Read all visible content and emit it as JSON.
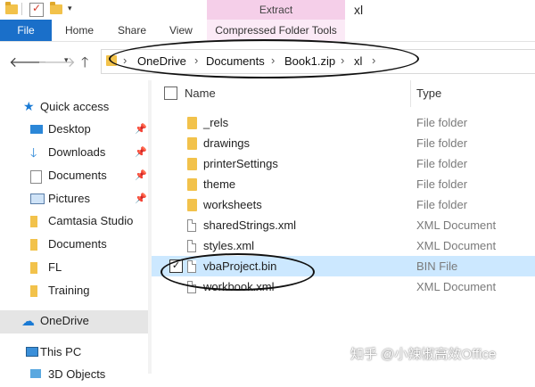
{
  "titlebar": {
    "contextual_group": "Extract",
    "window_title": "xl"
  },
  "ribbon": {
    "file": "File",
    "home": "Home",
    "share": "Share",
    "view": "View",
    "contextual_tab": "Compressed Folder Tools"
  },
  "address": {
    "back_icon": "arrow-left-icon",
    "forward_icon": "arrow-right-icon",
    "recent_icon": "chevron-down-icon",
    "up_icon": "arrow-up-icon",
    "crumbs": [
      "OneDrive",
      "Documents",
      "Book1.zip",
      "xl"
    ],
    "sep": "›"
  },
  "nav": {
    "quick_access": "Quick access",
    "items": [
      {
        "label": "Desktop",
        "icon": "desktop-icon",
        "pinned": true
      },
      {
        "label": "Downloads",
        "icon": "downloads-icon",
        "pinned": true
      },
      {
        "label": "Documents",
        "icon": "documents-icon",
        "pinned": true
      },
      {
        "label": "Pictures",
        "icon": "pictures-icon",
        "pinned": true
      },
      {
        "label": "Camtasia Studio",
        "icon": "folder-icon",
        "pinned": false
      },
      {
        "label": "Documents",
        "icon": "folder-icon",
        "pinned": false
      },
      {
        "label": "FL",
        "icon": "folder-icon",
        "pinned": false
      },
      {
        "label": "Training",
        "icon": "folder-icon",
        "pinned": false
      }
    ],
    "onedrive": "OneDrive",
    "this_pc": "This PC",
    "objects": "3D Objects"
  },
  "list": {
    "col_name": "Name",
    "col_type": "Type",
    "files": [
      {
        "name": "_rels",
        "type": "File folder",
        "icon": "folder-icon",
        "selected": false
      },
      {
        "name": "drawings",
        "type": "File folder",
        "icon": "folder-icon",
        "selected": false
      },
      {
        "name": "printerSettings",
        "type": "File folder",
        "icon": "folder-icon",
        "selected": false
      },
      {
        "name": "theme",
        "type": "File folder",
        "icon": "folder-icon",
        "selected": false
      },
      {
        "name": "worksheets",
        "type": "File folder",
        "icon": "folder-icon",
        "selected": false
      },
      {
        "name": "sharedStrings.xml",
        "type": "XML Document",
        "icon": "document-icon",
        "selected": false
      },
      {
        "name": "styles.xml",
        "type": "XML Document",
        "icon": "document-icon",
        "selected": false
      },
      {
        "name": "vbaProject.bin",
        "type": "BIN File",
        "icon": "document-icon",
        "selected": true
      },
      {
        "name": "workbook.xml",
        "type": "XML Document",
        "icon": "document-icon",
        "selected": false
      }
    ]
  },
  "watermark": "知乎 @小辣椒高效Office",
  "colors": {
    "accent": "#1a6fc9",
    "selection": "#cce8ff",
    "contextual": "#f5cfe9"
  }
}
